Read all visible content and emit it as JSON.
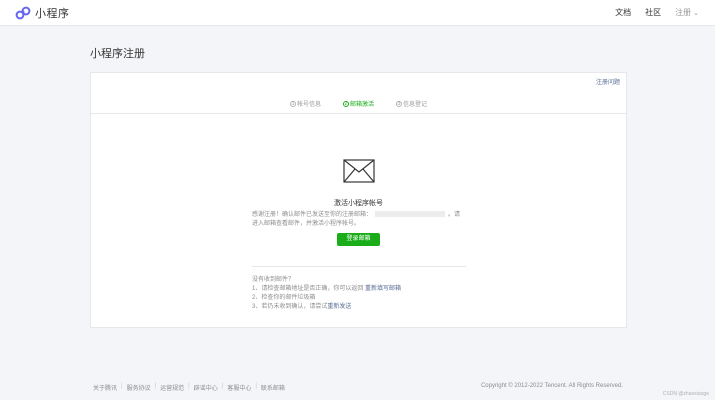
{
  "header": {
    "brand": "小程序",
    "nav": [
      {
        "label": "文档",
        "name": "nav-docs"
      },
      {
        "label": "社区",
        "name": "nav-community"
      },
      {
        "label": "注册",
        "name": "nav-user"
      }
    ]
  },
  "page": {
    "title": "小程序注册"
  },
  "card": {
    "help_link": "注册问题",
    "steps": [
      {
        "num": "1",
        "label": "帐号信息",
        "active": false
      },
      {
        "num": "2",
        "label": "邮箱激活",
        "active": true
      },
      {
        "num": "3",
        "label": "信息登记",
        "active": false
      }
    ],
    "activation": {
      "title": "激活小程序帐号",
      "desc_before": "感谢注册！确认邮件已发送至你的注册邮箱：",
      "desc_after": "。请进入邮箱查看邮件，并激活小程序帐号。",
      "button": "登录邮箱"
    },
    "faq": {
      "title": "没有收到邮件？",
      "items": [
        {
          "prefix": "1、请检查邮箱地址是否正确，你可以返回 ",
          "link": "重新填写邮箱",
          "suffix": ""
        },
        {
          "prefix": "2、检查你的邮件垃圾箱",
          "link": "",
          "suffix": ""
        },
        {
          "prefix": "3、若仍未收到确认，请尝试",
          "link": "重新发送",
          "suffix": ""
        }
      ]
    }
  },
  "footer": {
    "links": [
      "关于腾讯",
      "服务协议",
      "运营规范",
      "辟谣中心",
      "客服中心",
      "联系邮箱"
    ],
    "copyright": "Copyright © 2012-2022 Tencent. All Rights Reserved.",
    "watermark": "CSDN @zhaoxiaoge"
  },
  "colors": {
    "accent": "#1aad19",
    "link": "#576b95"
  }
}
